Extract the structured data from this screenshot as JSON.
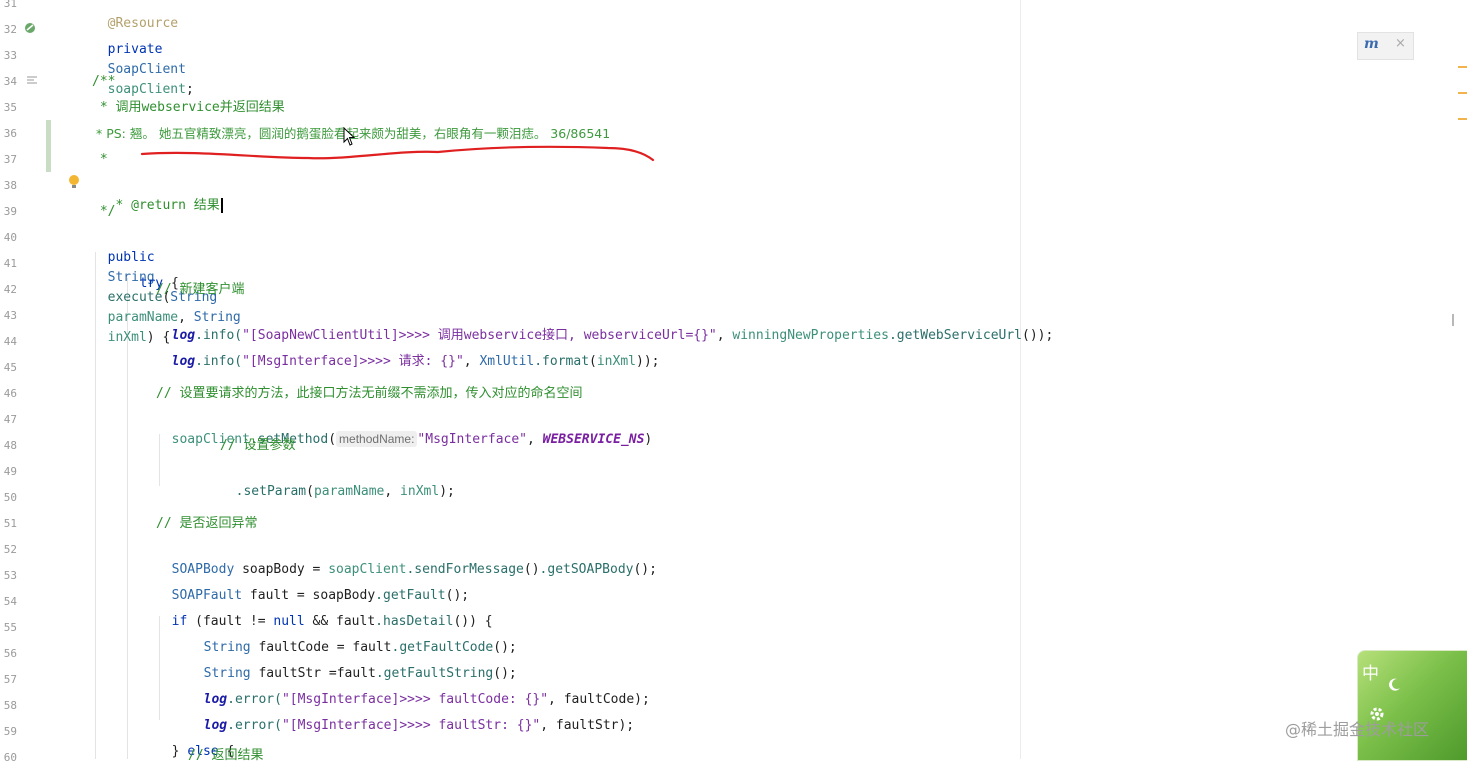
{
  "gutter": {
    "line_numbers": [
      "31",
      "32",
      "33",
      "34",
      "35",
      "36",
      "37",
      "38",
      "39",
      "40",
      "41",
      "42",
      "43",
      "44",
      "45",
      "46",
      "47",
      "48",
      "49",
      "50",
      "51",
      "52",
      "53",
      "54",
      "55",
      "56",
      "57",
      "58",
      "59",
      "60"
    ]
  },
  "code": {
    "l31": {
      "annotation": "@Resource"
    },
    "l32": {
      "kw": "private",
      "type": "SoapClient",
      "field": "soapClient",
      "end": ";"
    },
    "l34": {
      "text": "/**"
    },
    "l35": {
      "text": " * 调用webservice并返回结果"
    },
    "l36": {
      "text": " * PS: 翘。 她五官精致漂亮，圆润的鹅蛋脸看起来颇为甜美，右眼角有一颗泪痣。 36/86541"
    },
    "l37": {
      "text": " *"
    },
    "l38": {
      "text": " * @return 结果"
    },
    "l39": {
      "text": " */"
    },
    "l40": {
      "kw": "public",
      "type1": "String",
      "name": "execute",
      "open": "(",
      "type2": "String",
      "param1": "paramName",
      "comma": ", ",
      "type3": "String",
      "param2": "inXml",
      "close": ") {"
    },
    "l41": {
      "kw": "try",
      "rest": " {"
    },
    "l42": {
      "comment": "// 新建客户端"
    },
    "l43": {
      "log": "log",
      "call": ".info(",
      "str": "\"[SoapNewClientUtil]>>>> 调用webservice接口, webserviceUrl={}\"",
      "comma": ", ",
      "obj": "winningNewProperties",
      "method": ".getWebServiceUrl",
      "end": "());"
    },
    "l44": {
      "log": "log",
      "call": ".info(",
      "str": "\"[MsgInterface]>>>> 请求: {}\"",
      "comma": ", ",
      "obj": "XmlUtil",
      "method": ".format",
      "open": "(",
      "arg": "inXml",
      "end": "));"
    },
    "l46": {
      "comment": "// 设置要请求的方法，此接口方法无前缀不需添加，传入对应的命名空间"
    },
    "l47": {
      "obj": "soapClient",
      "method": ".setMethod",
      "open": "(",
      "hint": "methodName:",
      "str": "\"MsgInterface\"",
      "comma": ", ",
      "const": "WEBSERVICE_NS",
      "end": ")"
    },
    "l48": {
      "comment": "// 设置参数"
    },
    "l49": {
      "method": ".setParam",
      "open": "(",
      "arg1": "paramName",
      "comma": ", ",
      "arg2": "inXml",
      "end": ");"
    },
    "l51": {
      "comment": "// 是否返回异常"
    },
    "l52": {
      "type": "SOAPBody",
      "var": " soapBody = ",
      "obj": "soapClient",
      "m1": ".sendForMessage",
      "p1": "()",
      "m2": ".getSOAPBody",
      "end": "();"
    },
    "l53": {
      "type": "SOAPFault",
      "var": " fault = soapBody",
      "m1": ".getFault",
      "end": "();"
    },
    "l54": {
      "kw": "if",
      "a": " (fault != ",
      "kw2": "null",
      "b": " && fault",
      "m1": ".hasDetail",
      "end": "()) {"
    },
    "l55": {
      "type": "String",
      "var": " faultCode = fault",
      "m1": ".getFaultCode",
      "end": "();"
    },
    "l56": {
      "type": "String",
      "var": " faultStr =fault",
      "m1": ".getFaultString",
      "end": "();"
    },
    "l57": {
      "log": "log",
      "call": ".error(",
      "str": "\"[MsgInterface]>>>> faultCode: {}\"",
      "rest": ", faultCode);"
    },
    "l58": {
      "log": "log",
      "call": ".error(",
      "str": "\"[MsgInterface]>>>> faultStr: {}\"",
      "rest": ", faultStr);"
    },
    "l59": {
      "a": "} ",
      "kw": "else",
      "b": " {"
    },
    "l60": {
      "comment": "// 返回结果"
    }
  },
  "popup": {
    "logo": "m",
    "close": "×"
  },
  "ime": {
    "char": "中"
  },
  "watermark": {
    "text": "@稀土掘金技术社区"
  },
  "colors": {
    "keyword": "#0033b3",
    "string": "#7a2f9f",
    "comment": "#2f8f2f",
    "red_underline": "#e02020"
  }
}
